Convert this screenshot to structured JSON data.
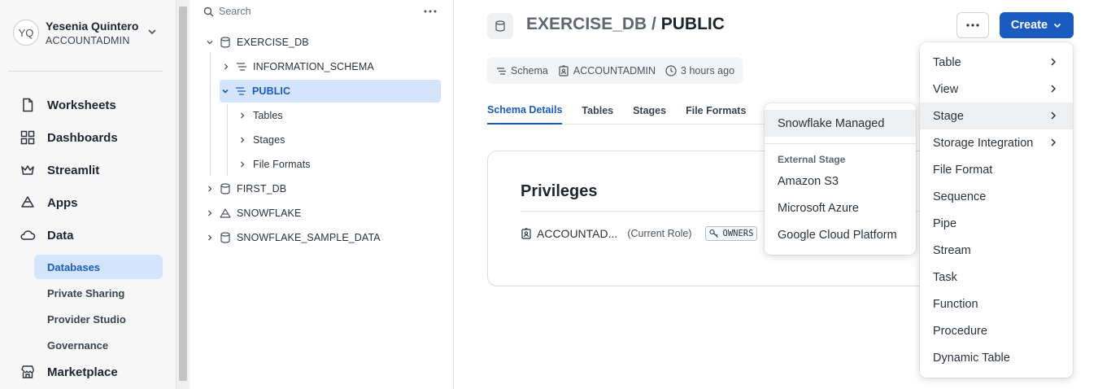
{
  "user": {
    "initials": "YQ",
    "name": "Yesenia Quintero",
    "role": "ACCOUNTADMIN"
  },
  "nav": {
    "items": [
      {
        "label": "Worksheets",
        "icon": "document-icon"
      },
      {
        "label": "Dashboards",
        "icon": "grid-icon"
      },
      {
        "label": "Streamlit",
        "icon": "crown-icon"
      },
      {
        "label": "Apps",
        "icon": "apps-icon"
      },
      {
        "label": "Data",
        "icon": "cloud-icon"
      },
      {
        "label": "Marketplace",
        "icon": "store-icon"
      }
    ],
    "data_sub": [
      "Databases",
      "Private Sharing",
      "Provider Studio",
      "Governance"
    ],
    "active_sub": "Databases"
  },
  "tree": {
    "search_placeholder": "Search",
    "nodes": [
      {
        "label": "EXERCISE_DB",
        "type": "database",
        "expanded": true
      },
      {
        "label": "INFORMATION_SCHEMA",
        "type": "schema",
        "expanded": false
      },
      {
        "label": "PUBLIC",
        "type": "schema",
        "expanded": true,
        "selected": true
      },
      {
        "label": "Tables",
        "type": "folder"
      },
      {
        "label": "Stages",
        "type": "folder"
      },
      {
        "label": "File Formats",
        "type": "folder"
      },
      {
        "label": "FIRST_DB",
        "type": "database",
        "expanded": false
      },
      {
        "label": "SNOWFLAKE",
        "type": "app",
        "expanded": false
      },
      {
        "label": "SNOWFLAKE_SAMPLE_DATA",
        "type": "database",
        "expanded": false
      }
    ]
  },
  "header": {
    "title_db": "EXERCISE_DB /",
    "title_schema": "PUBLIC",
    "create_label": "Create"
  },
  "meta": {
    "type": "Schema",
    "owner": "ACCOUNTADMIN",
    "updated": "3 hours ago"
  },
  "tabs": [
    "Schema Details",
    "Tables",
    "Stages",
    "File Formats"
  ],
  "active_tab": "Schema Details",
  "privileges": {
    "title": "Privileges",
    "role": "ACCOUNTAD...",
    "current": "(Current Role)",
    "badge": "OWNERS"
  },
  "create_menu": [
    "Table",
    "View",
    "Stage",
    "Storage Integration",
    "File Format",
    "Sequence",
    "Pipe",
    "Stream",
    "Task",
    "Function",
    "Procedure",
    "Dynamic Table"
  ],
  "create_menu_hover": "Stage",
  "stage_menu": {
    "managed": "Snowflake Managed",
    "group_label": "External Stage",
    "external": [
      "Amazon S3",
      "Microsoft Azure",
      "Google Cloud Platform"
    ]
  },
  "colors": {
    "accent": "#1a5bbf",
    "selection": "#d4e4fc"
  }
}
